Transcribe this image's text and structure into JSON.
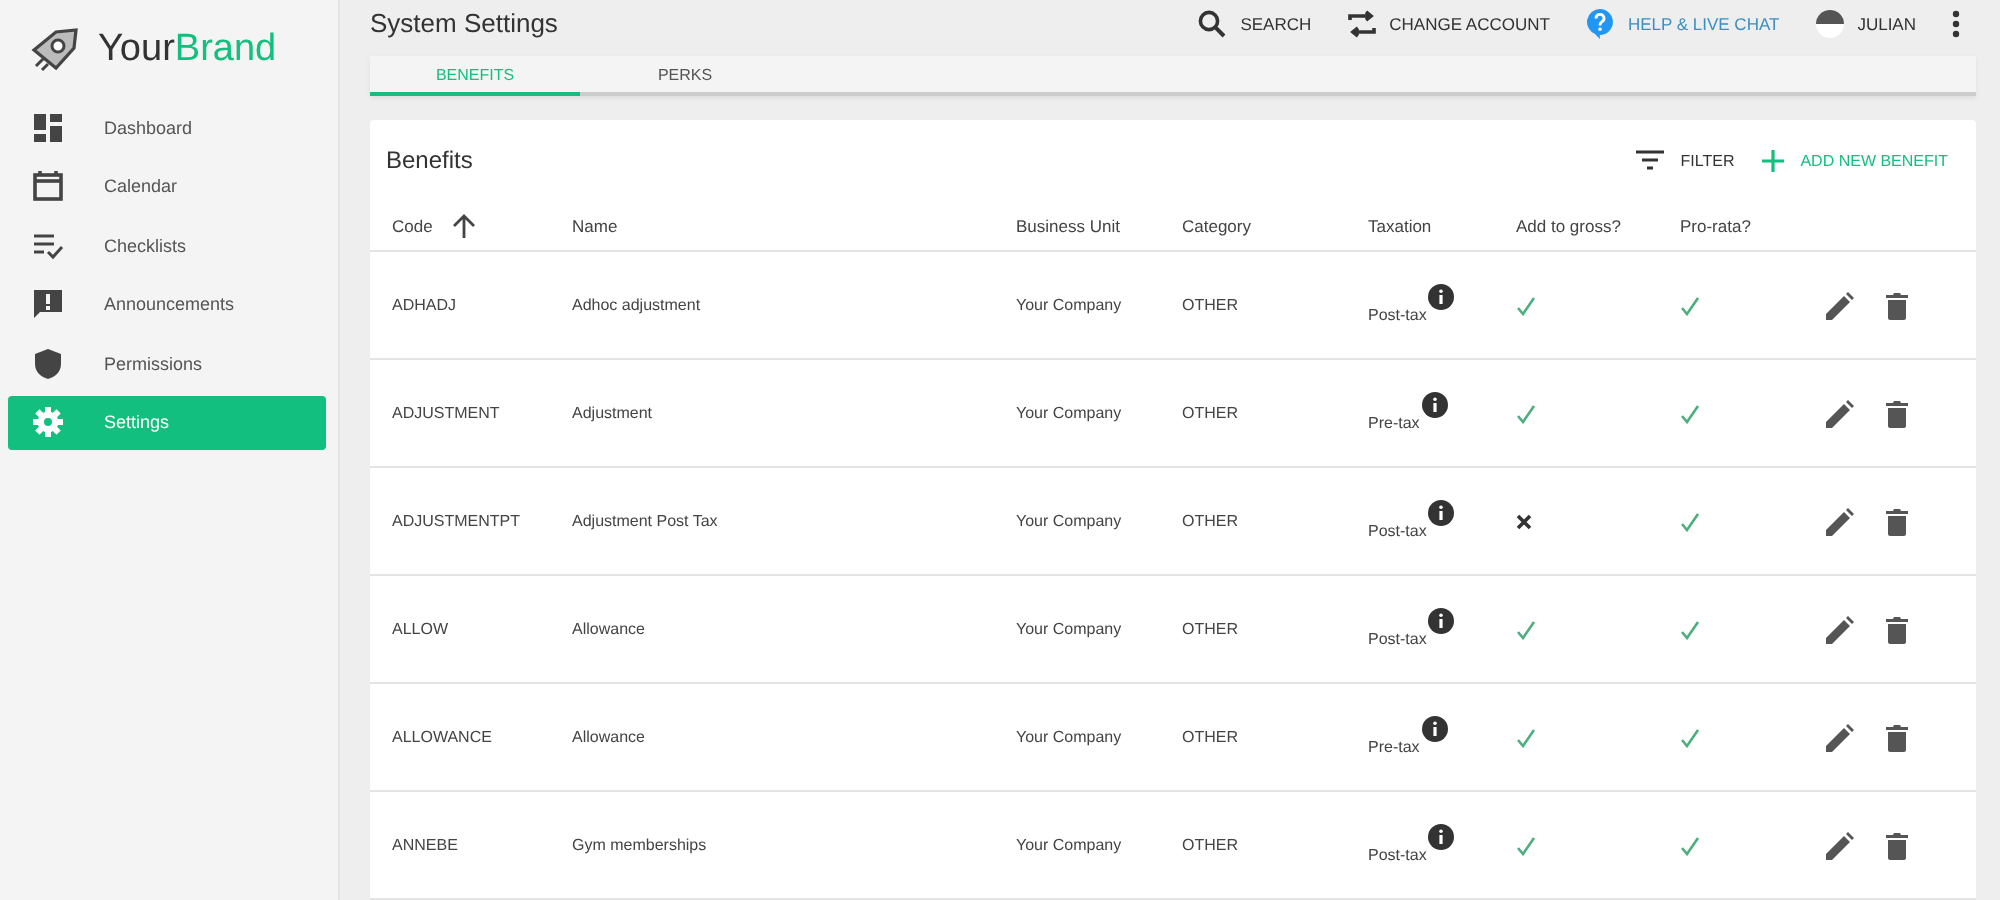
{
  "brand": {
    "first": "Your",
    "second": "Brand"
  },
  "sidebar": {
    "items": [
      {
        "label": "Dashboard",
        "selected": false
      },
      {
        "label": "Calendar",
        "selected": false
      },
      {
        "label": "Checklists",
        "selected": false
      },
      {
        "label": "Announcements",
        "selected": false
      },
      {
        "label": "Permissions",
        "selected": false
      },
      {
        "label": "Settings",
        "selected": true
      }
    ]
  },
  "header": {
    "title": "System Settings",
    "search": "SEARCH",
    "change_account": "CHANGE ACCOUNT",
    "help": "HELP & LIVE CHAT",
    "user": "JULIAN"
  },
  "tabs": [
    {
      "label": "BENEFITS",
      "selected": true
    },
    {
      "label": "PERKS",
      "selected": false
    }
  ],
  "table": {
    "title": "Benefits",
    "filter": "FILTER",
    "add": "ADD NEW BENEFIT",
    "columns": [
      "Code",
      "Name",
      "Business Unit",
      "Category",
      "Taxation",
      "Add to gross?",
      "Pro-rata?"
    ],
    "rows": [
      {
        "code": "ADHADJ",
        "name": "Adhoc adjustment",
        "business_unit": "Your Company",
        "category": "OTHER",
        "taxation": "Post-tax",
        "add_to_gross": true,
        "pro_rata": true
      },
      {
        "code": "ADJUSTMENT",
        "name": "Adjustment",
        "business_unit": "Your Company",
        "category": "OTHER",
        "taxation": "Pre-tax",
        "add_to_gross": true,
        "pro_rata": true
      },
      {
        "code": "ADJUSTMENTPT",
        "name": "Adjustment Post Tax",
        "business_unit": "Your Company",
        "category": "OTHER",
        "taxation": "Post-tax",
        "add_to_gross": false,
        "pro_rata": true
      },
      {
        "code": "ALLOW",
        "name": "Allowance",
        "business_unit": "Your Company",
        "category": "OTHER",
        "taxation": "Post-tax",
        "add_to_gross": true,
        "pro_rata": true
      },
      {
        "code": "ALLOWANCE",
        "name": "Allowance",
        "business_unit": "Your Company",
        "category": "OTHER",
        "taxation": "Pre-tax",
        "add_to_gross": true,
        "pro_rata": true
      },
      {
        "code": "ANNEBE",
        "name": "Gym memberships",
        "business_unit": "Your Company",
        "category": "OTHER",
        "taxation": "Post-tax",
        "add_to_gross": true,
        "pro_rata": true
      }
    ]
  }
}
